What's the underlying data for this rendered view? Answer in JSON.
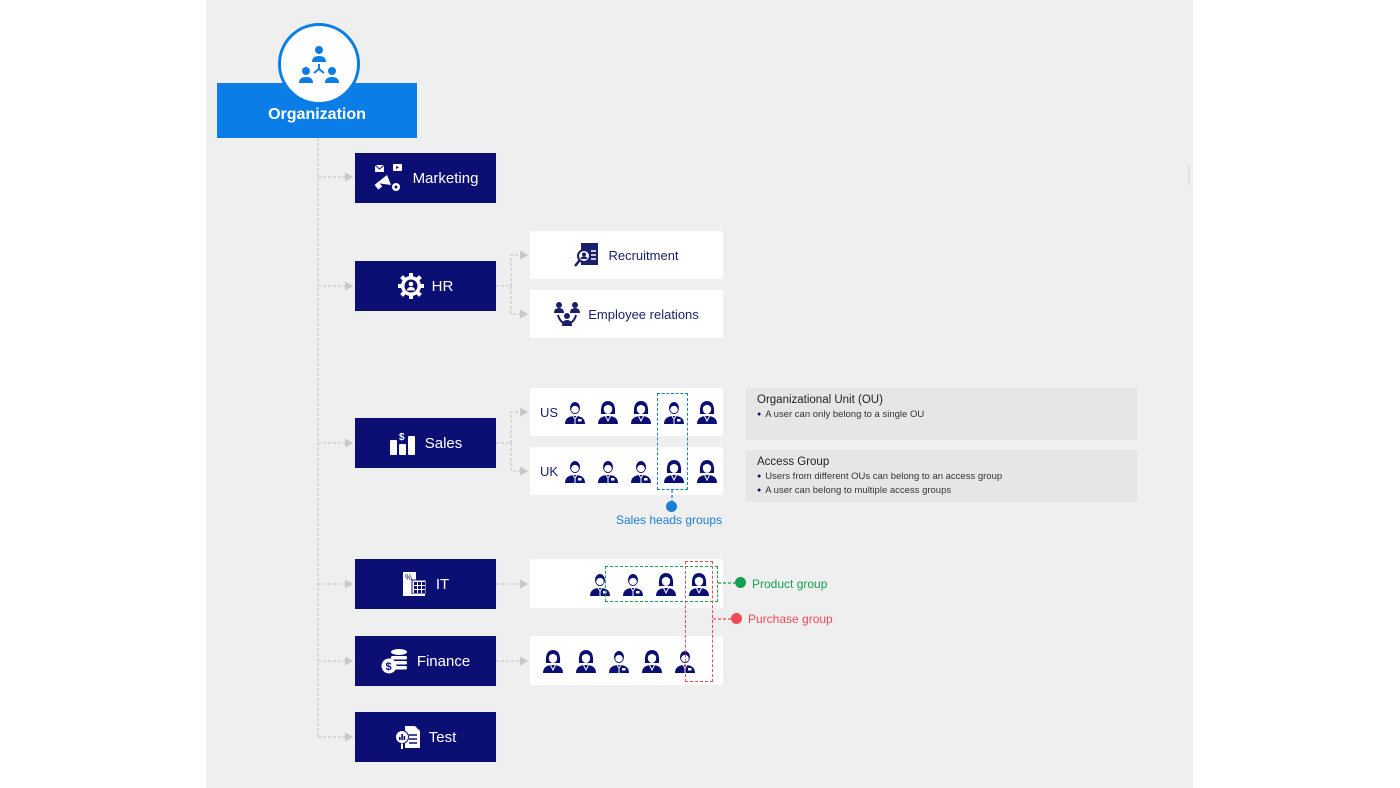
{
  "diagram": {
    "root": {
      "label": "Organization",
      "icon": "org-hierarchy-icon"
    },
    "departments": [
      {
        "id": "marketing",
        "label": "Marketing",
        "icon": "megaphone-icon"
      },
      {
        "id": "hr",
        "label": "HR",
        "icon": "gear-person-icon",
        "children": [
          {
            "label": "Recruitment",
            "icon": "recruitment-search-icon"
          },
          {
            "label": "Employee relations",
            "icon": "team-icon"
          }
        ]
      },
      {
        "id": "sales",
        "label": "Sales",
        "icon": "sales-chart-icon",
        "children": [
          {
            "label": "US",
            "members": [
              "male",
              "female",
              "female",
              "male",
              "female"
            ]
          },
          {
            "label": "UK",
            "members": [
              "male",
              "male",
              "male",
              "female",
              "female"
            ]
          }
        ]
      },
      {
        "id": "it",
        "label": "IT",
        "icon": "calculator-doc-icon",
        "members": [
          "male",
          "male",
          "female",
          "female"
        ]
      },
      {
        "id": "finance",
        "label": "Finance",
        "icon": "coins-icon",
        "members": [
          "female",
          "female",
          "male",
          "female",
          "male"
        ]
      },
      {
        "id": "test",
        "label": "Test",
        "icon": "test-report-icon"
      }
    ],
    "groups": {
      "sales_heads": {
        "label": "Sales heads groups",
        "color": "#1a7fd4"
      },
      "product": {
        "label": "Product group",
        "color": "#12a150"
      },
      "purchase": {
        "label": "Purchase group",
        "color": "#ef4a55"
      }
    },
    "legend": [
      {
        "title": "Organizational Unit (OU)",
        "bullets": [
          "A user can only belong to a single OU"
        ]
      },
      {
        "title": "Access Group",
        "bullets": [
          "Users from different OUs can belong to an access group",
          "A user can belong to multiple access groups"
        ]
      }
    ]
  },
  "colors": {
    "root": "#0a7ee6",
    "department": "#0b0f73",
    "canvas": "#efefef"
  }
}
